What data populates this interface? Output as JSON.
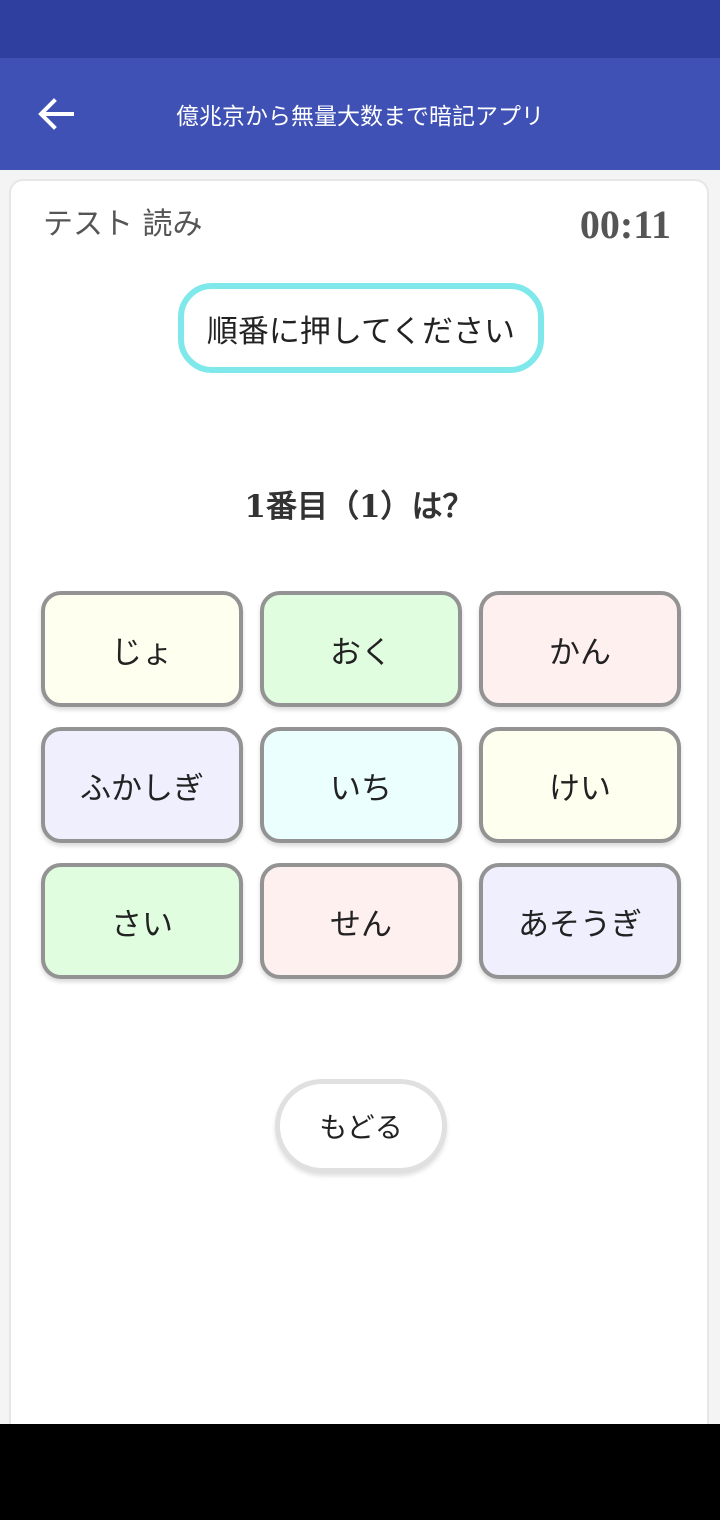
{
  "app_bar": {
    "title": "億兆京から無量大数まで暗記アプリ",
    "back_icon": "arrow-left-icon"
  },
  "quiz": {
    "mode_label": "テスト 読み",
    "timer": "00:11",
    "instruction": "順番に押してください",
    "question": "1番目（1）は？",
    "tiles": [
      {
        "label": "じょ",
        "color": "#fffff0"
      },
      {
        "label": "おく",
        "color": "#e0fde0"
      },
      {
        "label": "かん",
        "color": "#fff0f0"
      },
      {
        "label": "ふかしぎ",
        "color": "#efeffd"
      },
      {
        "label": "いち",
        "color": "#ebffff"
      },
      {
        "label": "けい",
        "color": "#fffff0"
      },
      {
        "label": "さい",
        "color": "#e0fde0"
      },
      {
        "label": "せん",
        "color": "#fff0f0"
      },
      {
        "label": "あそうぎ",
        "color": "#efeffd"
      }
    ],
    "back_button_label": "もどる"
  },
  "colors": {
    "status_bar": "#2f3f9f",
    "app_bar": "#3f51b5",
    "instruction_border": "#7ee8ea",
    "tile_border": "#939393"
  }
}
